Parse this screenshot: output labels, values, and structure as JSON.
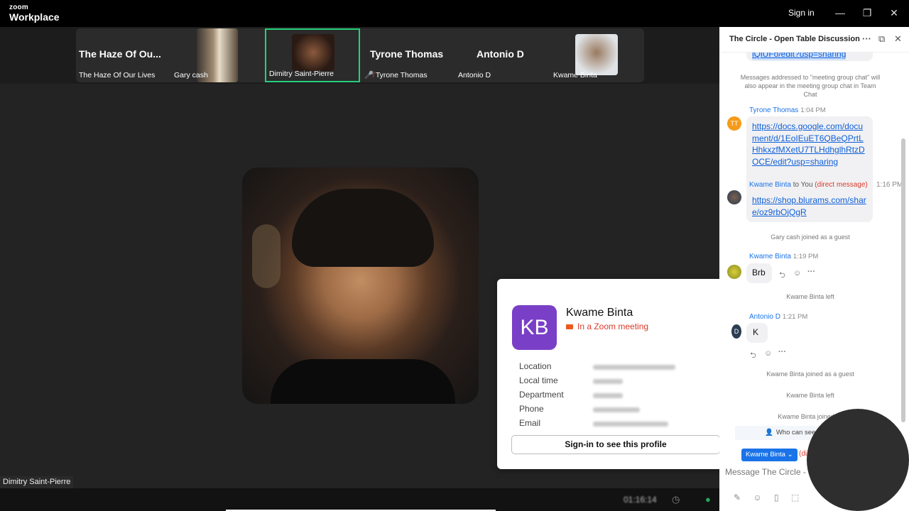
{
  "titlebar": {
    "logo_line1": "zoom",
    "logo_line2": "Workplace",
    "signin": "Sign in",
    "minimize": "—",
    "restore": "❐",
    "close": "✕"
  },
  "strip": {
    "tiles": [
      {
        "big": "The Haze Of Ou...",
        "name": "The Haze Of Our Lives"
      },
      {
        "big": "",
        "name": "Gary cash"
      },
      {
        "big": "",
        "name": "Dimitry Saint-Pierre"
      },
      {
        "big": "Tyrone Thomas",
        "name": "Tyrone Thomas"
      },
      {
        "big": "Antonio D",
        "name": "Antonio D"
      },
      {
        "big": "",
        "name": "Kwame Binta"
      }
    ]
  },
  "speaker": {
    "name": "Dimitry Saint-Pierre"
  },
  "bottom": {
    "timer": "01:16:14"
  },
  "profile": {
    "initials": "KB",
    "name": "Kwame Binta",
    "status": "In a Zoom meeting",
    "fields": [
      "Location",
      "Local time",
      "Department",
      "Phone",
      "Email"
    ],
    "signin_button": "Sign-in to see this profile"
  },
  "chat": {
    "title": "The Circle - Open Table Discussion",
    "top_link": "lQlUFo/edit?usp=sharing",
    "notice": "Messages addressed to \"meeting group chat\" will also appear in the meeting group chat in Team Chat",
    "m1": {
      "initials": "TT",
      "sender": "Tyrone Thomas",
      "time": "1:04 PM",
      "link": "https://docs.google.com/document/d/1EoIEuET6QBeQPrtLHhkxzfMXetU7TLHdhglhRtzDOCE/edit?usp=sharing"
    },
    "m2": {
      "sender": "Kwame Binta",
      "to": " to You ",
      "dm": "(direct message)",
      "time": "1:16 PM",
      "link": "https://shop.blurams.com/share/oz9rbOjQgR"
    },
    "sys1": "Gary cash joined as a guest",
    "m3": {
      "sender": "Kwame Binta",
      "time": "1:19 PM",
      "text": "Brb"
    },
    "sys2": "Kwame Binta left",
    "m4": {
      "initials": "D",
      "sender": "Antonio D",
      "time": "1:21 PM",
      "text": "K"
    },
    "sys3": "Kwame Binta joined as a guest",
    "sys4": "Kwame Binta left",
    "sys5": "Kwame Binta joined as",
    "whocan": "Who can see",
    "recipient": "Kwame Binta ⌄",
    "recipient_tag": "(di",
    "input_placeholder": "Message The Circle -"
  }
}
